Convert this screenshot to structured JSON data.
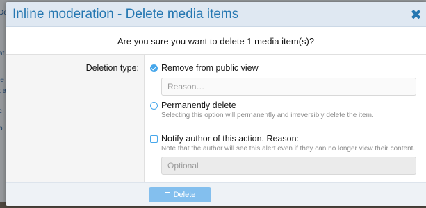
{
  "dialog": {
    "title": "Inline moderation - Delete media items",
    "close_glyph": "✖",
    "question": "Are you sure you want to delete 1 media item(s)?",
    "deletion_type_label": "Deletion type:",
    "options": {
      "remove": {
        "label": "Remove from public view",
        "checked": true,
        "reason_placeholder": "Reason…"
      },
      "permanent": {
        "label": "Permanently delete",
        "hint": "Selecting this option will permanently and irreversibly delete the item.",
        "checked": false
      },
      "notify": {
        "label": "Notify author of this action. Reason:",
        "hint": "Note that the author will see this alert even if they can no longer view their content.",
        "placeholder": "Optional",
        "checked": false
      }
    },
    "submit": {
      "label": "Delete",
      "icon": "trash-icon"
    }
  },
  "background": {
    "fragments": [
      "Dele",
      "at",
      "le",
      "t a",
      "c",
      "p"
    ]
  },
  "colors": {
    "accent": "#2577b1",
    "radio": "#47a7eb",
    "button": "#83bfee",
    "titlebar": "#dfe8f2"
  }
}
